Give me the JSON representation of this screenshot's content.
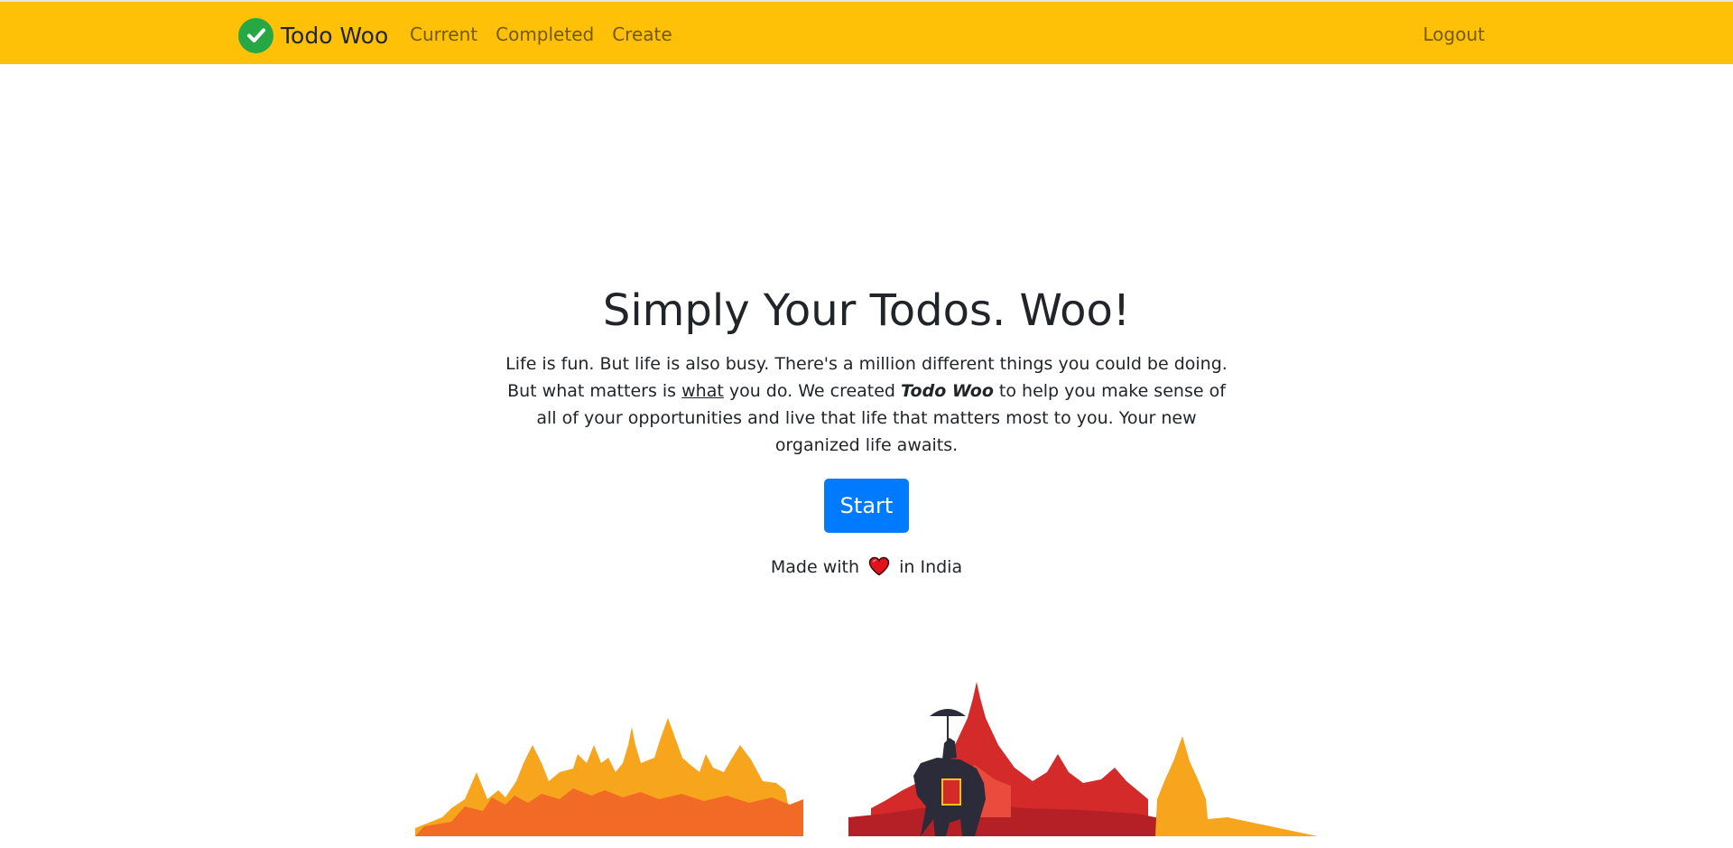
{
  "navbar": {
    "brand": "Todo Woo",
    "links": [
      "Current",
      "Completed",
      "Create"
    ],
    "logout": "Logout",
    "background": "#ffc107"
  },
  "hero": {
    "title": "Simply Your Todos. Woo!",
    "text_1": "Life is fun. But life is also busy. There's a million different things you could be doing. But what matters is ",
    "text_emphasis": "what",
    "text_2": " you do. We created ",
    "text_brand": "Todo Woo",
    "text_3": " to help you make sense of all of your opportunities and live that life that matters most to you. Your new organized life awaits.",
    "button_label": "Start",
    "button_color": "#007bff"
  },
  "footer": {
    "made_with": "Made with",
    "in_place": "in India",
    "heart_icon": "heart-icon"
  },
  "illustration": {
    "name": "india-skyline-with-elephant",
    "colors": [
      "#f7a51c",
      "#f26b26",
      "#d42a2a",
      "#2b2b3a"
    ]
  }
}
